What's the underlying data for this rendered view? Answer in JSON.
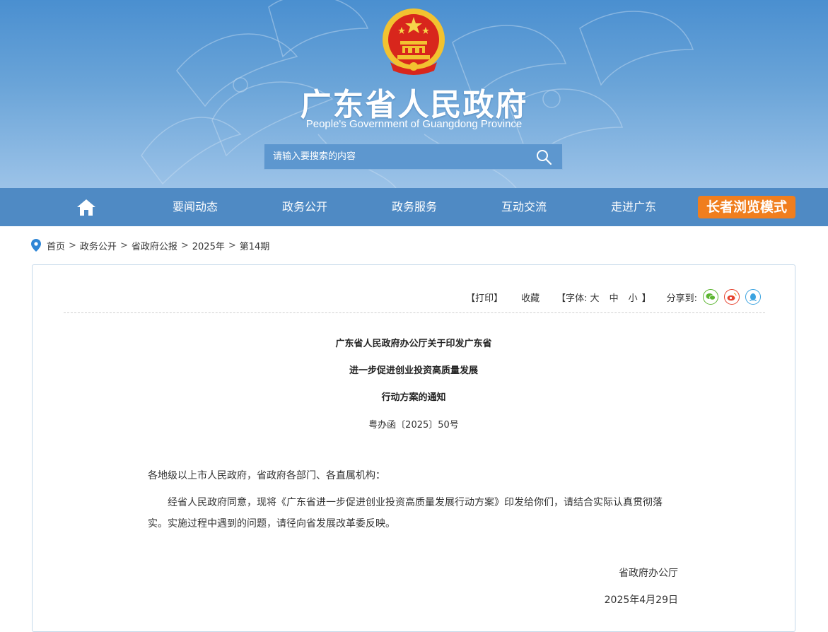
{
  "header": {
    "title": "广东省人民政府",
    "subtitle": "People's Government of Guangdong Province",
    "emblem_icon": "national-emblem",
    "search_placeholder": "请输入要搜索的内容",
    "search_icon": "search-icon"
  },
  "nav": {
    "home_icon": "home-icon",
    "items": [
      {
        "label": "要闻动态"
      },
      {
        "label": "政务公开"
      },
      {
        "label": "政务服务"
      },
      {
        "label": "互动交流"
      },
      {
        "label": "走进广东"
      }
    ],
    "elder_mode_label": "长者浏览模式",
    "elder_mode_color": "#f07e1e",
    "bar_color": "#4f8ac4"
  },
  "breadcrumb": {
    "pin_icon": "location-pin-icon",
    "items": [
      "首页",
      "政务公开",
      "省政府公报",
      "2025年",
      "第14期"
    ],
    "separator": ">"
  },
  "toolbar": {
    "print": "【打印】",
    "favorite": "收藏",
    "font_prefix": "【字体:",
    "font_large": "大",
    "font_medium": "中",
    "font_small": "小",
    "font_suffix": "】",
    "share_label": "分享到:",
    "share_icons": [
      "wechat-icon",
      "weibo-icon",
      "qq-icon"
    ],
    "share_colors": {
      "wechat": "#5cb531",
      "weibo": "#e6432f",
      "qq": "#3ba3e0"
    }
  },
  "document": {
    "title_lines": [
      "广东省人民政府办公厅关于印发广东省",
      "进一步促进创业投资高质量发展",
      "行动方案的通知"
    ],
    "doc_number": "粤办函〔2025〕50号",
    "salutation": "各地级以上市人民政府，省政府各部门、各直属机构：",
    "body": "经省人民政府同意，现将《广东省进一步促进创业投资高质量发展行动方案》印发给你们，请结合实际认真贯彻落实。实施过程中遇到的问题，请径向省发展改革委反映。",
    "issuer": "省政府办公厅",
    "date": "2025年4月29日"
  }
}
